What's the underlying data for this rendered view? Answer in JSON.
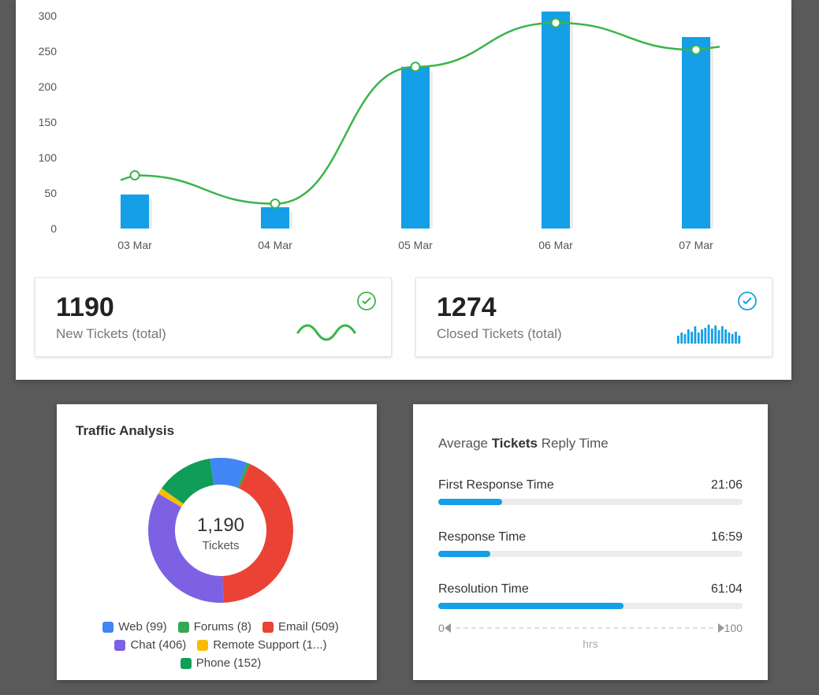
{
  "chart_data": [
    {
      "type": "bar+line",
      "categories": [
        "03 Mar",
        "04 Mar",
        "05 Mar",
        "06 Mar",
        "07 Mar"
      ],
      "bar_values": [
        48,
        30,
        228,
        306,
        270
      ],
      "line_values": [
        75,
        35,
        228,
        290,
        252
      ],
      "ylim": [
        0,
        300
      ],
      "yticks": [
        0,
        50,
        100,
        150,
        200,
        250,
        300
      ],
      "bar_color": "#149fe6",
      "line_color": "#3cb44a"
    },
    {
      "type": "donut",
      "title": "Traffic Analysis",
      "center_value": "1,190",
      "center_label": "Tickets",
      "total": 1190,
      "slices": [
        {
          "name": "Web",
          "value": 99,
          "color": "#4285F4"
        },
        {
          "name": "Forums",
          "value": 8,
          "color": "#34A853"
        },
        {
          "name": "Email",
          "value": 509,
          "color": "#EA4335"
        },
        {
          "name": "Chat",
          "value": 406,
          "color": "#7C62E3"
        },
        {
          "name": "Remote Support",
          "value": 16,
          "color": "#FBBC05",
          "display": "1..."
        },
        {
          "name": "Phone",
          "value": 152,
          "color": "#0F9D58"
        }
      ]
    },
    {
      "type": "progress",
      "title": "Average Tickets Reply Time",
      "scale_min": 0,
      "scale_max": 100,
      "unit": "hrs",
      "metrics": [
        {
          "name": "First Response Time",
          "value": "21:06",
          "pct": 21
        },
        {
          "name": "Response Time",
          "value": "16:59",
          "pct": 17
        },
        {
          "name": "Resolution Time",
          "value": "61:04",
          "pct": 61
        }
      ]
    }
  ],
  "summary": [
    {
      "value": "1190",
      "label": "New Tickets (total)",
      "icon": "check-circle",
      "icon_color": "#3cb44a",
      "mini": "wave",
      "mini_color": "#3cb44a"
    },
    {
      "value": "1274",
      "label": "Closed Tickets (total)",
      "icon": "check-circle",
      "icon_color": "#149fe6",
      "mini": "bars",
      "mini_color": "#149fe6"
    }
  ]
}
